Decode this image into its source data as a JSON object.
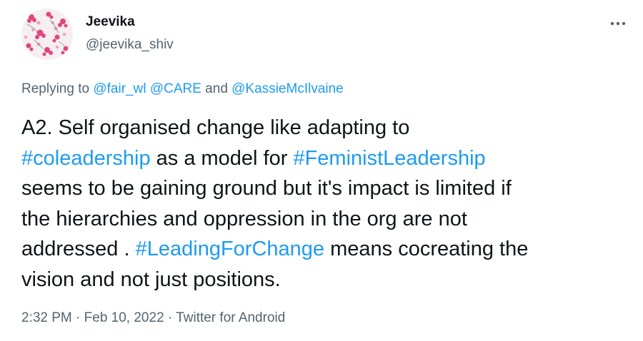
{
  "author": {
    "name": "Jeevika",
    "handle": "@jeevika_shiv",
    "avatar": "floral-pattern-avatar"
  },
  "more_icon": "more-horizontal-icon",
  "reply_context": {
    "prefix": "Replying to ",
    "mentions": [
      "@fair_wl",
      "@CARE"
    ],
    "conjunction": " and ",
    "last_mention": "@KassieMcIlvaine"
  },
  "tweet": {
    "lines": [
      [
        {
          "text": "A2. Self organised change like adapting to",
          "type": "text"
        }
      ],
      [
        {
          "text": "#coleadership",
          "type": "hashtag"
        },
        {
          "text": " as a model for ",
          "type": "text"
        },
        {
          "text": "#FeministLeadership",
          "type": "hashtag"
        }
      ],
      [
        {
          "text": "seems to be gaining ground but it's impact is limited if",
          "type": "text"
        }
      ],
      [
        {
          "text": "the hierarchies and oppression in the org are not",
          "type": "text"
        }
      ],
      [
        {
          "text": "addressed . ",
          "type": "text"
        },
        {
          "text": "#LeadingForChange",
          "type": "hashtag"
        },
        {
          "text": " means cocreating the",
          "type": "text"
        }
      ],
      [
        {
          "text": "vision and not just positions.",
          "type": "text"
        }
      ]
    ]
  },
  "meta": {
    "time": "2:32 PM",
    "separator": " · ",
    "date": "Feb 10, 2022",
    "source": "Twitter for Android"
  },
  "colors": {
    "link": "#1d9bf0",
    "secondary_text": "#536471",
    "primary_text": "#0f1419"
  }
}
